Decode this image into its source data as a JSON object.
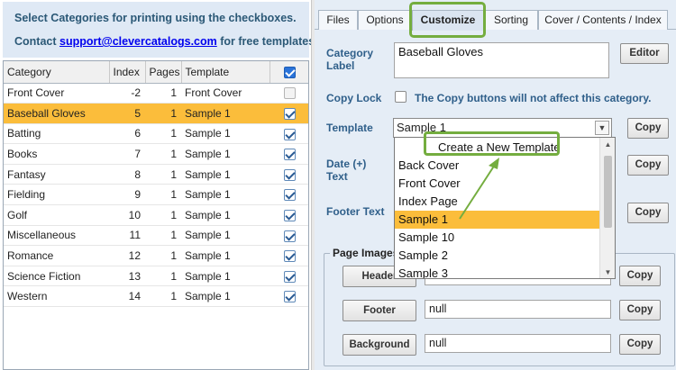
{
  "info": {
    "line1": "Select Categories for printing using the checkboxes.",
    "contact_prefix": "Contact",
    "contact_email": "support@clevercatalogs.com",
    "contact_suffix": "for free templates."
  },
  "table": {
    "columns": [
      "Category",
      "Index",
      "Pages",
      "Template"
    ],
    "rows": [
      {
        "category": "Front Cover",
        "index": "-2",
        "pages": "1",
        "template": "Front Cover",
        "checked": false,
        "disabled": true,
        "selected": false
      },
      {
        "category": "Baseball Gloves",
        "index": "5",
        "pages": "1",
        "template": "Sample 1",
        "checked": true,
        "disabled": false,
        "selected": true
      },
      {
        "category": "Batting",
        "index": "6",
        "pages": "1",
        "template": "Sample 1",
        "checked": true,
        "disabled": false,
        "selected": false
      },
      {
        "category": "Books",
        "index": "7",
        "pages": "1",
        "template": "Sample 1",
        "checked": true,
        "disabled": false,
        "selected": false
      },
      {
        "category": "Fantasy",
        "index": "8",
        "pages": "1",
        "template": "Sample 1",
        "checked": true,
        "disabled": false,
        "selected": false
      },
      {
        "category": "Fielding",
        "index": "9",
        "pages": "1",
        "template": "Sample 1",
        "checked": true,
        "disabled": false,
        "selected": false
      },
      {
        "category": "Golf",
        "index": "10",
        "pages": "1",
        "template": "Sample 1",
        "checked": true,
        "disabled": false,
        "selected": false
      },
      {
        "category": "Miscellaneous",
        "index": "11",
        "pages": "1",
        "template": "Sample 1",
        "checked": true,
        "disabled": false,
        "selected": false
      },
      {
        "category": "Romance",
        "index": "12",
        "pages": "1",
        "template": "Sample 1",
        "checked": true,
        "disabled": false,
        "selected": false
      },
      {
        "category": "Science Fiction",
        "index": "13",
        "pages": "1",
        "template": "Sample 1",
        "checked": true,
        "disabled": false,
        "selected": false
      },
      {
        "category": "Western",
        "index": "14",
        "pages": "1",
        "template": "Sample 1",
        "checked": true,
        "disabled": false,
        "selected": false
      }
    ]
  },
  "tabs": [
    {
      "label": "Files",
      "active": false
    },
    {
      "label": "Options",
      "active": false
    },
    {
      "label": "Customize",
      "active": true
    },
    {
      "label": "Sorting",
      "active": false
    },
    {
      "label": "Cover / Contents / Index",
      "active": false
    }
  ],
  "customize": {
    "category_label": "Category\nLabel",
    "category_value": "Baseball Gloves",
    "editor_button": "Editor",
    "copy_lock_label": "Copy Lock",
    "copy_lock_note": "The Copy buttons will not affect this category.",
    "template_label": "Template",
    "template_value": "Sample 1",
    "copy_button": "Copy",
    "date_text_label": "Date (+)\nText",
    "footer_text_label": "Footer Text",
    "page_images_legend": "Page Images",
    "header_button": "Header",
    "footer_button": "Footer",
    "background_button": "Background",
    "footer_image_value": "null",
    "background_image_value": "null"
  },
  "dropdown": {
    "options": [
      "Create a New Template",
      "Back Cover",
      "Front Cover",
      "Index Page",
      "Sample 1",
      "Sample 10",
      "Sample 2",
      "Sample 3"
    ],
    "selected": "Sample 1"
  },
  "colors": {
    "selection": "#fbbd3b",
    "highlight_outline": "#74ad3f",
    "label_blue": "#2f5f8a",
    "panel_bg": "#e5edf6"
  }
}
